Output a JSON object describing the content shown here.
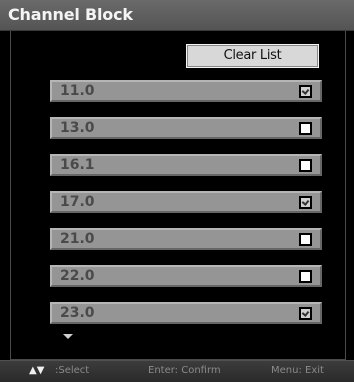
{
  "window": {
    "title": "Channel Block"
  },
  "toolbar": {
    "clear_label": "Clear List"
  },
  "channels": [
    {
      "label": "11.0",
      "checked": true
    },
    {
      "label": "13.0",
      "checked": false
    },
    {
      "label": "16.1",
      "checked": false
    },
    {
      "label": "17.0",
      "checked": true
    },
    {
      "label": "21.0",
      "checked": false
    },
    {
      "label": "22.0",
      "checked": false
    },
    {
      "label": "23.0",
      "checked": true
    }
  ],
  "footer": {
    "nav_arrows": "▲▼",
    "select_hint": ":Select",
    "confirm_hint": "Enter: Confirm",
    "exit_hint": "Menu: Exit"
  },
  "icons": {
    "scroll": "chevron-down-icon",
    "checkbox": "checkbox-icon"
  },
  "colors": {
    "title_bar": "#5e5e5e",
    "row_fill": "#959595",
    "row_text": "#4a4a4a",
    "button_fill": "#d8d8d8",
    "footer_text": "#8a8a8a"
  }
}
